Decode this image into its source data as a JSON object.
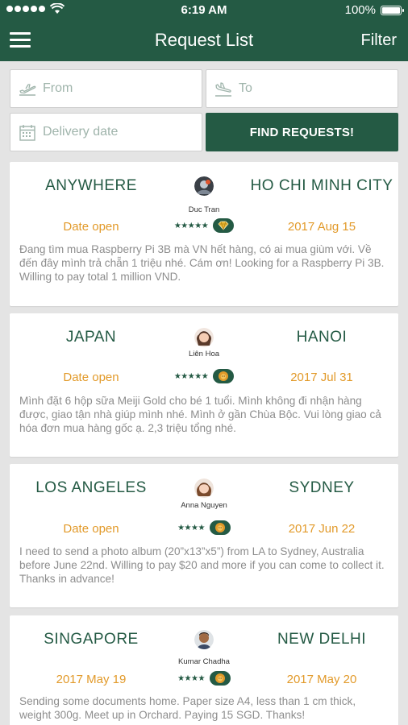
{
  "status": {
    "time": "6:19 AM",
    "battery": "100%"
  },
  "nav": {
    "title": "Request List",
    "filter": "Filter"
  },
  "search": {
    "from_placeholder": "From",
    "to_placeholder": "To",
    "date_placeholder": "Delivery date",
    "find_label": "FIND REQUESTS!"
  },
  "requests": [
    {
      "from": "ANYWHERE",
      "to": "HO CHI MINH CITY",
      "user": "Duc Tran",
      "stars": "★★★★★",
      "rating": 5,
      "badge_icon": "diamond-badge-icon",
      "date_from": "Date open",
      "date_to": "2017 Aug 15",
      "description": "Đang tìm mua Raspberry Pi 3B mà VN hết hàng, có ai mua giùm với. Về đến đây mình trả chẵn 1 triệu nhé. Cám ơn! Looking for a Raspberry Pi 3B. Willing to pay total 1 million VND."
    },
    {
      "from": "JAPAN",
      "to": "HANOI",
      "user": "Liên Hoa",
      "stars": "★★★★★",
      "rating": 5,
      "badge_icon": "lion-badge-icon",
      "date_from": "Date open",
      "date_to": "2017 Jul 31",
      "description": "Mình đặt 6 hộp sữa Meiji Gold cho bé 1 tuổi. Mình không đi nhận hàng được, giao tận nhà giúp mình nhé. Mình ở gần Chùa Bộc. Vui lòng giao cả hóa đơn mua hàng gốc ạ. 2,3 triệu tổng nhé."
    },
    {
      "from": "LOS ANGELES",
      "to": "SYDNEY",
      "user": "Anna Nguyen",
      "stars": "★★★★",
      "rating": 4,
      "badge_icon": "lion-badge-icon",
      "date_from": "Date open",
      "date_to": "2017 Jun 22",
      "description": "I need to send a photo album (20”x13”x5”) from LA to Sydney, Australia before June 22nd. Willing to pay $20 and more if you can come to collect it. Thanks in advance!"
    },
    {
      "from": "SINGAPORE",
      "to": "NEW DELHI",
      "user": "Kumar Chadha",
      "stars": "★★★★",
      "rating": 4,
      "badge_icon": "lion-badge-icon",
      "date_from": "2017 May 19",
      "date_to": "2017 May 20",
      "description": "Sending some documents home. Paper size A4, less than 1 cm thick, weight 300g. Meet up in Orchard. Paying 15 SGD. Thanks!"
    }
  ],
  "colors": {
    "primary": "#245a44",
    "accent": "#e29a2a",
    "text_muted": "#8d8d8d"
  }
}
